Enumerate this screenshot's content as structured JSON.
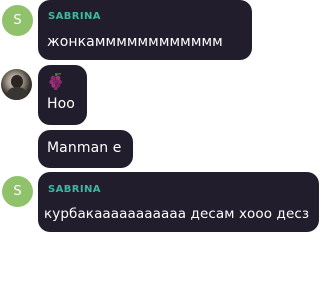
{
  "messages": [
    {
      "sender": "SABRINA",
      "avatar_letter": "S",
      "text": "жонкамммммммммммм"
    },
    {
      "sender": "",
      "avatar": "user-photo",
      "sticker": "grapes-icon",
      "text": "Hoo"
    },
    {
      "sender": "",
      "text": "Manman e"
    },
    {
      "sender": "SABRINA",
      "avatar_letter": "S",
      "text": "курбакааааааааааа десам хооо десз"
    }
  ],
  "colors": {
    "bubble": "#221d2d",
    "sender_name": "#3fb6a1",
    "avatar_letter_bg": "#8fc26b",
    "text": "#ffffff"
  }
}
